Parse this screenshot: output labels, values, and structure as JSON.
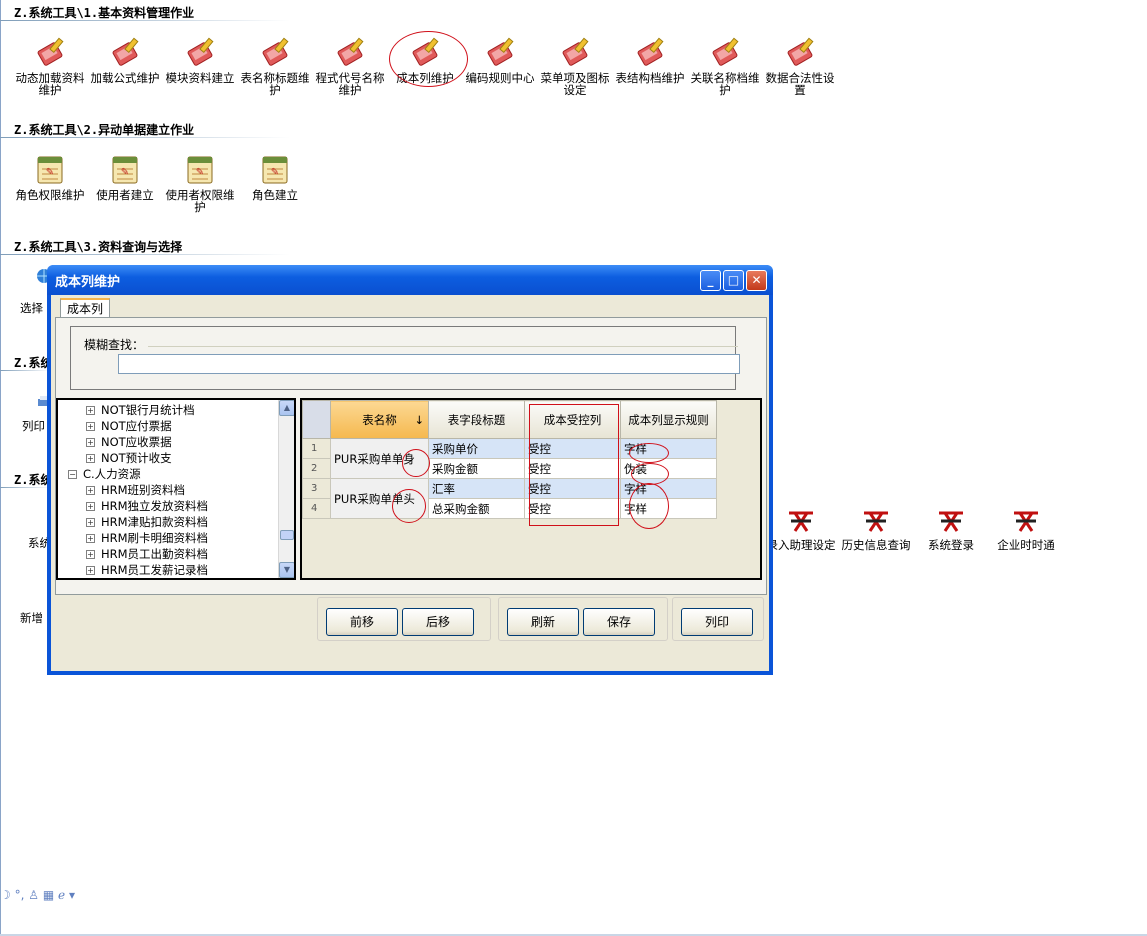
{
  "sections": [
    {
      "title": "Z.系统工具\\1.基本资料管理作业"
    },
    {
      "title": "Z.系统工具\\2.异动单据建立作业"
    },
    {
      "title": "Z.系统工具\\3.资料查询与选择"
    },
    {
      "title": "Z.系统"
    },
    {
      "title": "Z.系统"
    }
  ],
  "tools_row1": [
    {
      "label": "动态加载资料维护"
    },
    {
      "label": "加载公式维护"
    },
    {
      "label": "模块资料建立"
    },
    {
      "label": "表名称标题维护"
    },
    {
      "label": "程式代号名称维护"
    },
    {
      "label": "成本列维护"
    },
    {
      "label": "编码规则中心"
    },
    {
      "label": "菜单项及图标设定"
    },
    {
      "label": "表结构档维护"
    },
    {
      "label": "关联名称档维护"
    },
    {
      "label": "数据合法性设置"
    }
  ],
  "tools_row2": [
    {
      "label": "角色权限维护"
    },
    {
      "label": "使用者建立"
    },
    {
      "label": "使用者权限维护"
    },
    {
      "label": "角色建立"
    }
  ],
  "partial_labels": {
    "select": "选择",
    "print": "列印",
    "system": "系统",
    "add": "新增"
  },
  "tools_row4": [
    {
      "label": "录入助理设定"
    },
    {
      "label": "历史信息查询"
    },
    {
      "label": "系统登录"
    },
    {
      "label": "企业时时通"
    }
  ],
  "dialog": {
    "title": "成本列维护",
    "tab": "成本列",
    "search_label": "模糊查找：",
    "search_value": "",
    "tree": [
      {
        "label": "NOT银行月统计档",
        "sign": "+"
      },
      {
        "label": "NOT应付票据",
        "sign": "+"
      },
      {
        "label": "NOT应收票据",
        "sign": "+"
      },
      {
        "label": "NOT预计收支",
        "sign": "+"
      },
      {
        "label": "C.人力资源",
        "sign": "−"
      },
      {
        "label": "HRM班别资料档",
        "sign": "+"
      },
      {
        "label": "HRM独立发放资料档",
        "sign": "+"
      },
      {
        "label": "HRM津贴扣款资料档",
        "sign": "+"
      },
      {
        "label": "HRM刷卡明细资料档",
        "sign": "+"
      },
      {
        "label": "HRM员工出勤资料档",
        "sign": "+"
      },
      {
        "label": "HRM员工发薪记录档",
        "sign": "+"
      }
    ],
    "grid": {
      "headers": [
        "表名称",
        "表字段标题",
        "成本受控列",
        "成本列显示规则"
      ],
      "sort_arrow": "↓",
      "rows": [
        {
          "n": "1",
          "table": "PUR采购单单身",
          "field": "采购单价",
          "ctrl": "受控",
          "rule": "字样"
        },
        {
          "n": "2",
          "table": "",
          "field": "采购金额",
          "ctrl": "受控",
          "rule": "伪装"
        },
        {
          "n": "3",
          "table": "PUR采购单单头",
          "field": "汇率",
          "ctrl": "受控",
          "rule": "字样"
        },
        {
          "n": "4",
          "table": "",
          "field": "总采购金额",
          "ctrl": "受控",
          "rule": "字样"
        }
      ]
    },
    "buttons": {
      "prev": "前移",
      "next": "后移",
      "refresh": "刷新",
      "save": "保存",
      "print": "列印"
    }
  },
  "colors": {
    "titlebar": "#0a54d8",
    "annotation": "#d0101a",
    "client": "#ece9d8"
  }
}
